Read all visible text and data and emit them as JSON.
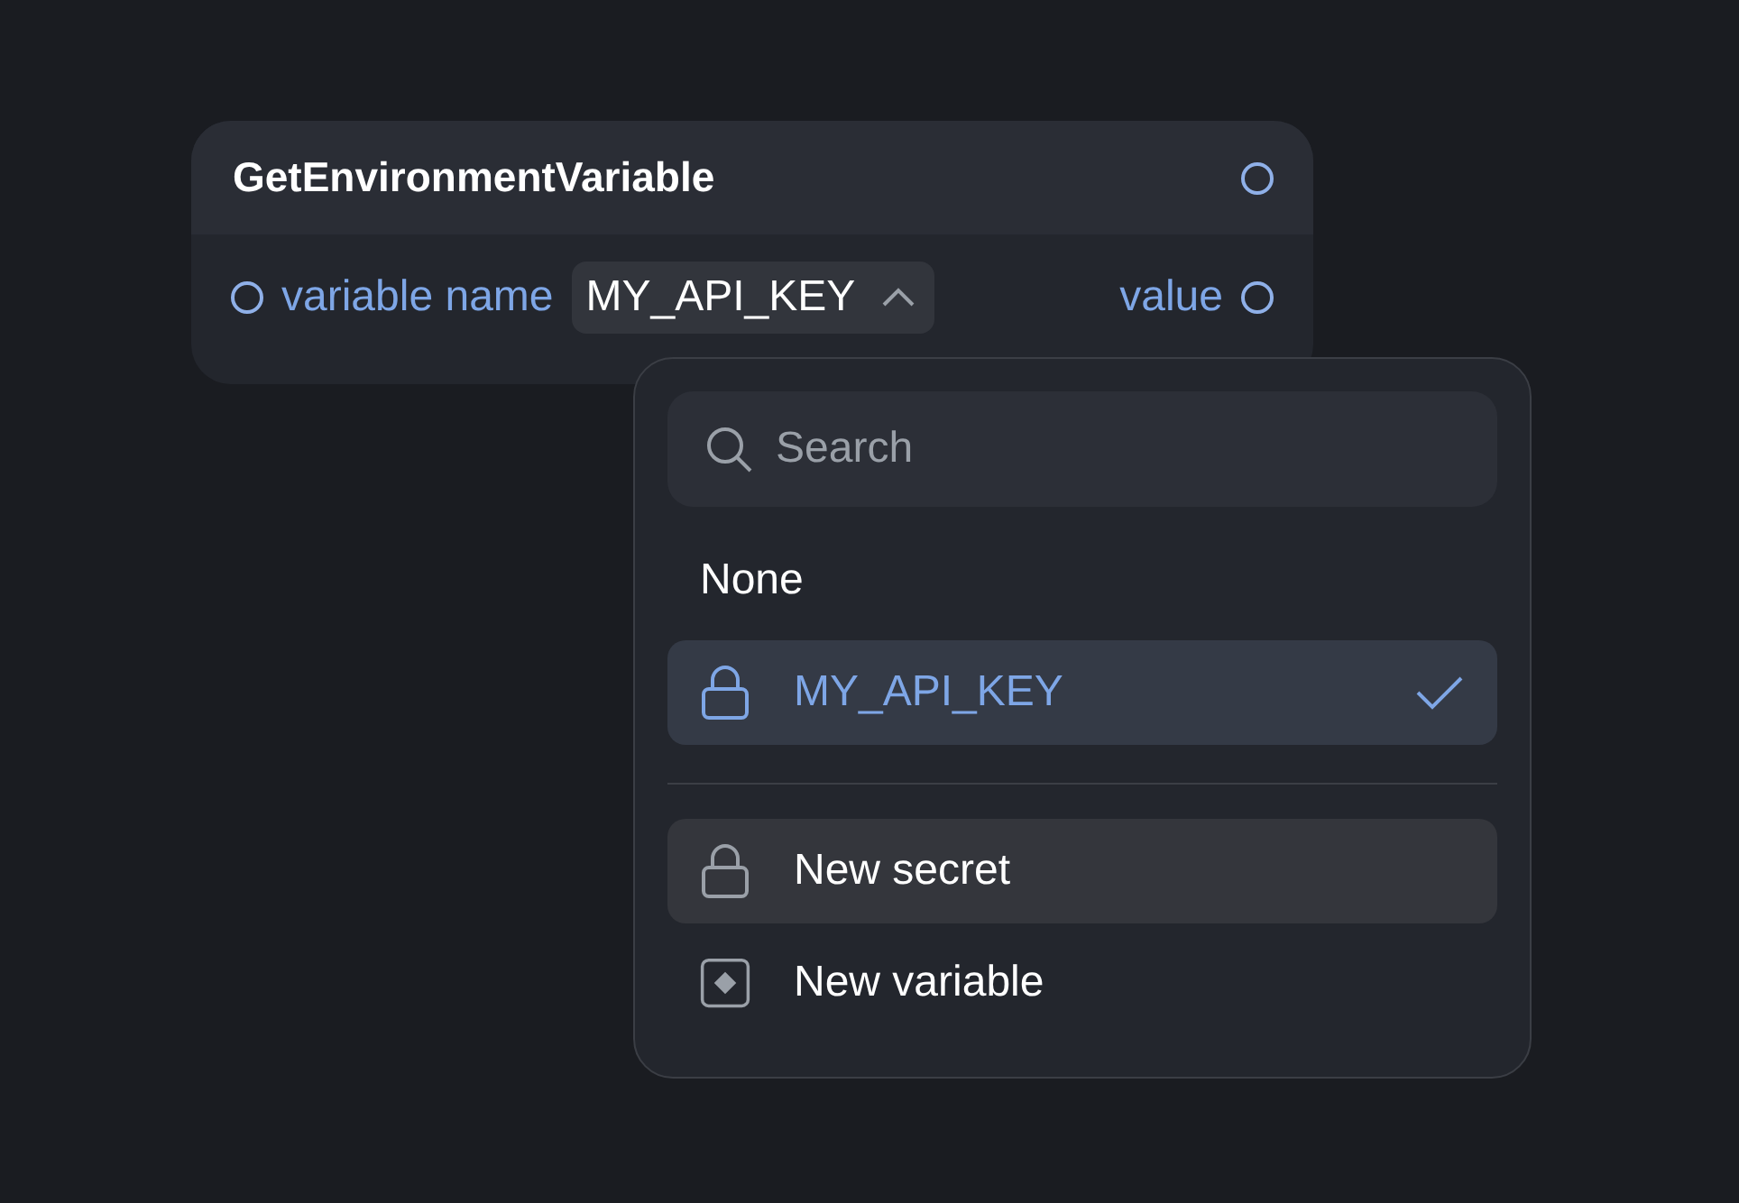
{
  "node": {
    "title": "GetEnvironmentVariable",
    "input": {
      "label": "variable name",
      "value": "MY_API_KEY",
      "expanded": true
    },
    "output": {
      "label": "value"
    }
  },
  "dropdown": {
    "search": {
      "placeholder": "Search"
    },
    "options": [
      {
        "label": "None",
        "kind": "plain",
        "selected": false
      },
      {
        "label": "MY_API_KEY",
        "kind": "secret",
        "selected": true
      }
    ],
    "actions": [
      {
        "label": "New secret",
        "kind": "secret",
        "highlighted": true
      },
      {
        "label": "New variable",
        "kind": "variable",
        "highlighted": false
      }
    ]
  }
}
